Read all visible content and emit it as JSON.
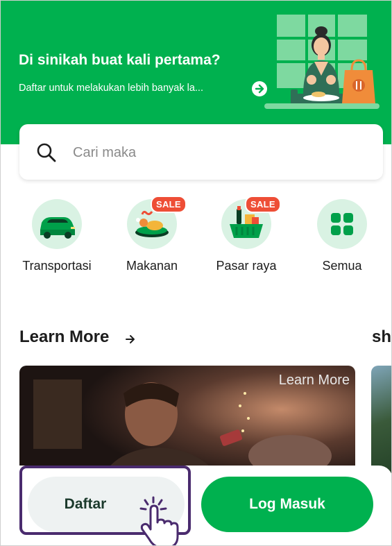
{
  "hero": {
    "title": "Di sinikah buat kali pertama?",
    "subtitle": "Daftar untuk melakukan lebih banyak la...",
    "arrow_icon": "arrow-right-icon",
    "background": "#00b14f"
  },
  "search": {
    "placeholder": "Cari maka",
    "icon": "search-icon"
  },
  "categories": [
    {
      "label": "Transportasi",
      "icon": "car-icon",
      "badge": ""
    },
    {
      "label": "Makanan",
      "icon": "food-plate-icon",
      "badge": "SALE"
    },
    {
      "label": "Pasar raya",
      "icon": "grocery-basket-icon",
      "badge": "SALE"
    },
    {
      "label": "Semua",
      "icon": "grid-icon",
      "badge": ""
    }
  ],
  "learn_more": {
    "title": "Learn More",
    "next_section_partial": "sho",
    "card_label": "Learn More"
  },
  "bottom_bar": {
    "register_label": "Daftar",
    "login_label": "Log Masuk"
  },
  "colors": {
    "brand_green": "#00b14f",
    "light_green": "#d9f2e3",
    "sale_red": "#ee4e36",
    "highlight_purple": "#4a2b6e"
  }
}
